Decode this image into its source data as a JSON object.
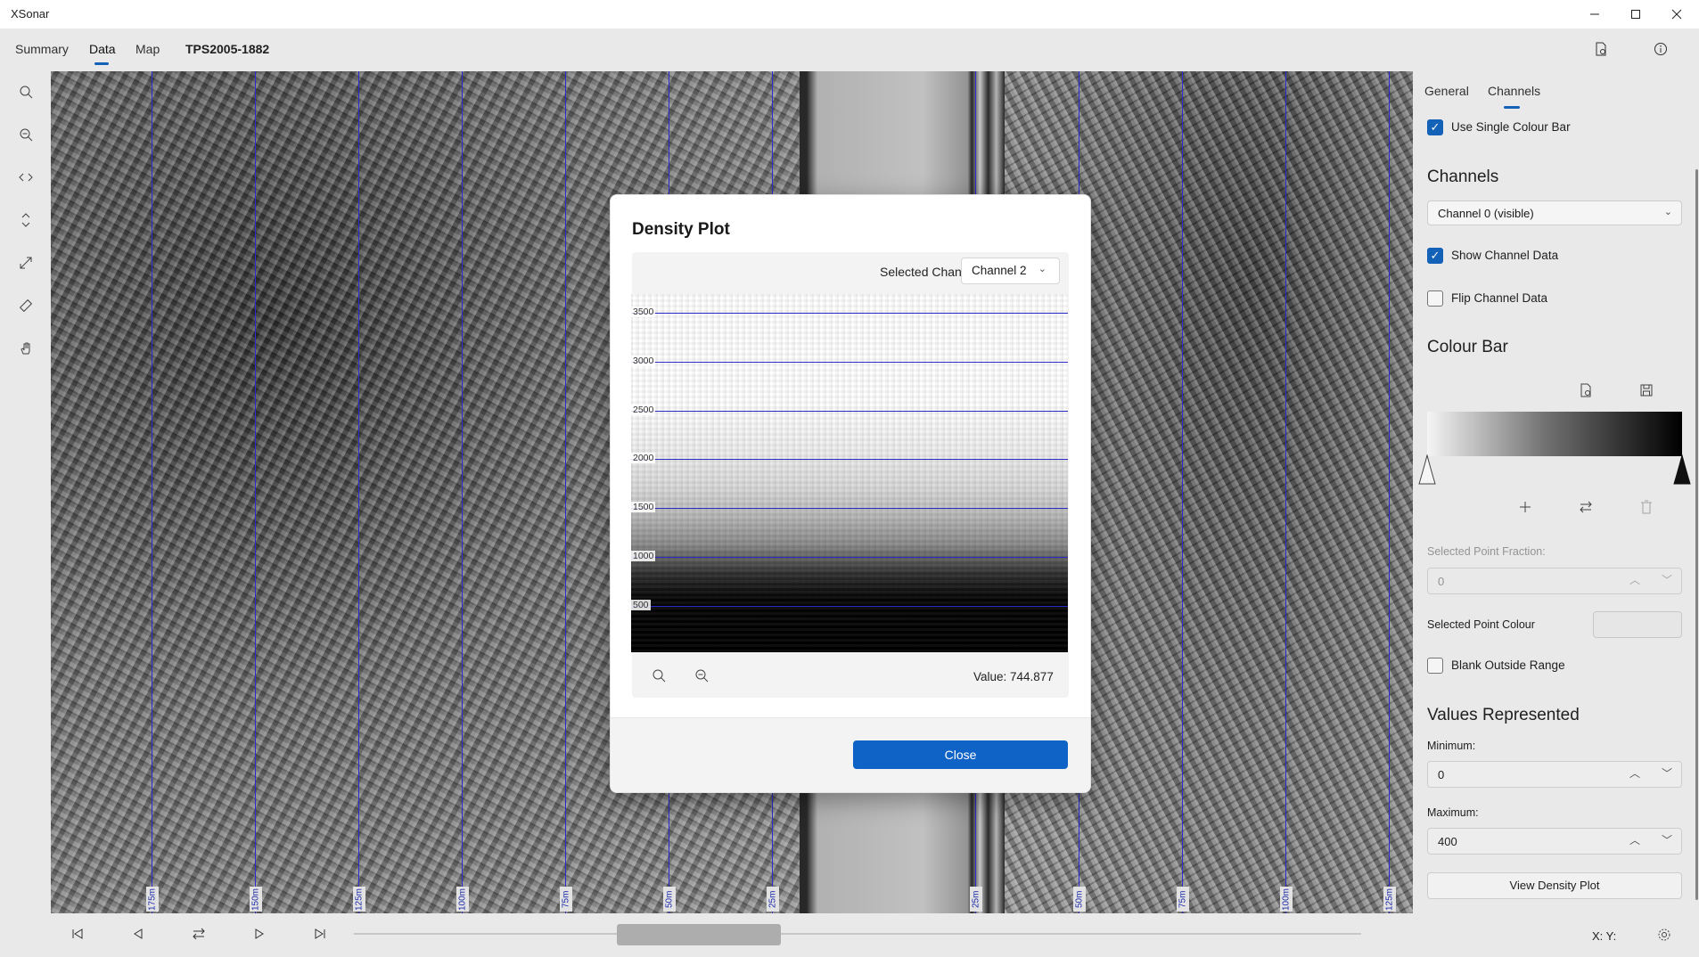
{
  "window": {
    "title": "XSonar"
  },
  "nav": {
    "tabs": [
      "Summary",
      "Data",
      "Map"
    ],
    "document": "TPS2005-1882"
  },
  "sonar": {
    "range_labels": [
      "175m",
      "150m",
      "125m",
      "100m",
      "75m",
      "50m",
      "25m",
      "25m",
      "50m",
      "75m",
      "100m",
      "125m"
    ]
  },
  "right_panel": {
    "tabs": [
      "General",
      "Channels"
    ],
    "use_single_colour_bar": "Use Single Colour Bar",
    "channels_heading": "Channels",
    "channel_select": "Channel 0 (visible)",
    "show_channel_data": "Show Channel Data",
    "flip_channel_data": "Flip Channel Data",
    "colour_bar_heading": "Colour Bar",
    "selected_point_fraction_label": "Selected Point Fraction:",
    "selected_point_fraction_value": "0",
    "selected_point_colour_label": "Selected Point Colour",
    "blank_outside_range": "Blank Outside Range",
    "values_heading": "Values Represented",
    "minimum_label": "Minimum:",
    "minimum_value": "0",
    "maximum_label": "Maximum:",
    "maximum_value": "400",
    "view_density_plot": "View Density Plot",
    "coords": "X:   Y:"
  },
  "dialog": {
    "title": "Density Plot",
    "selected_channel_label": "Selected Channel",
    "selected_channel_value": "Channel 2",
    "y_ticks": [
      "3500",
      "3000",
      "2500",
      "2000",
      "1500",
      "1000",
      "500"
    ],
    "value_text": "Value: 744.877",
    "close_label": "Close"
  },
  "colors": {
    "accent": "#0f62c6",
    "range_line": "#2b2bd6"
  }
}
